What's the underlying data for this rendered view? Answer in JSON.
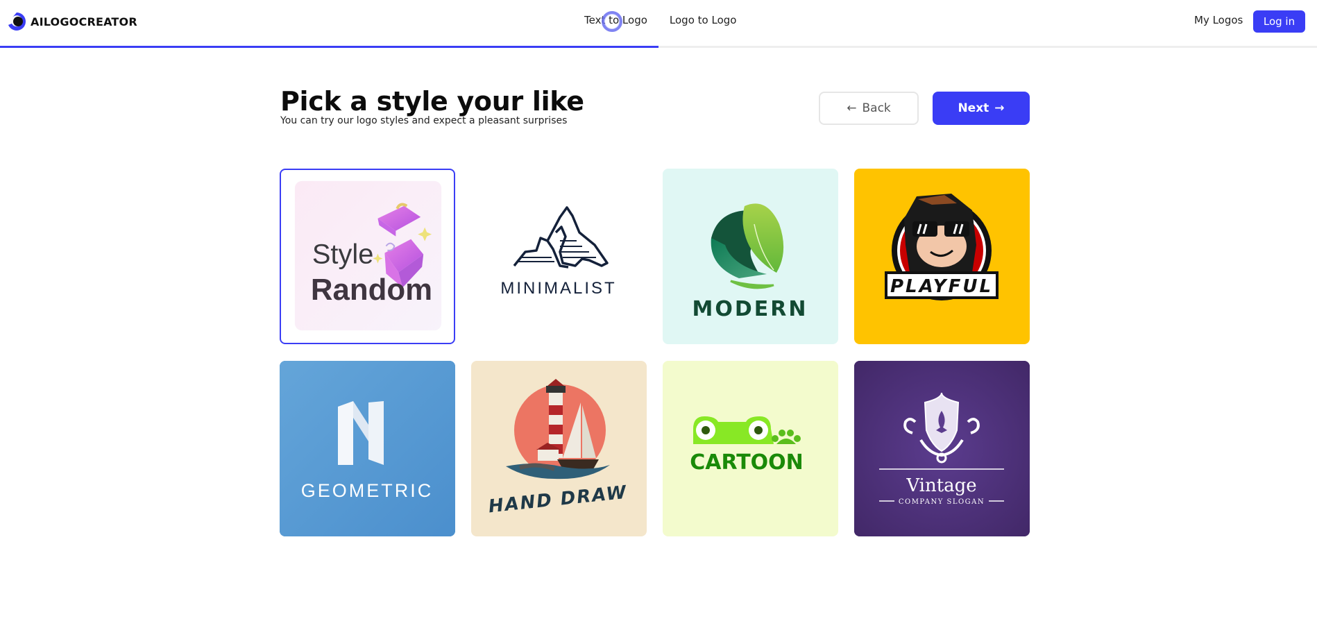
{
  "header": {
    "brand": "AILOGOCREATOR",
    "nav": [
      {
        "label": "Text to Logo"
      },
      {
        "label": "Logo to Logo"
      }
    ],
    "my_logos": "My Logos",
    "login": "Log in",
    "progress_percent": 50
  },
  "main": {
    "title": "Pick a style your like",
    "subtitle": "You can try our logo styles and expect a pleasant surprises",
    "back_label": "Back",
    "next_label": "Next",
    "back_icon": "arrow-left-icon",
    "next_icon": "arrow-right-icon"
  },
  "styles": [
    {
      "id": "random",
      "line1": "Style",
      "line2": "Random",
      "selected": true,
      "bg": "#f9eef7"
    },
    {
      "id": "minimalist",
      "label": "MINIMALIST",
      "selected": false,
      "bg": "#ffffff"
    },
    {
      "id": "modern",
      "label": "MODERN",
      "selected": false,
      "bg": "#e0f7f4"
    },
    {
      "id": "playful",
      "label": "PLAYFUL",
      "selected": false,
      "bg": "#ffc300"
    },
    {
      "id": "geometric",
      "label": "GEOMETRIC",
      "selected": false,
      "bg": "#4f95d2"
    },
    {
      "id": "hand-draw",
      "label": "HAND DRAW",
      "selected": false,
      "bg": "#f4e6cb"
    },
    {
      "id": "cartoon",
      "label": "CARTOON",
      "selected": false,
      "bg": "#f3fbcd"
    },
    {
      "id": "vintage",
      "label": "Vintage",
      "sublabel": "COMPANY SLOGAN",
      "selected": false,
      "bg": "#4a2f78"
    }
  ],
  "colors": {
    "accent": "#3a3df5"
  }
}
